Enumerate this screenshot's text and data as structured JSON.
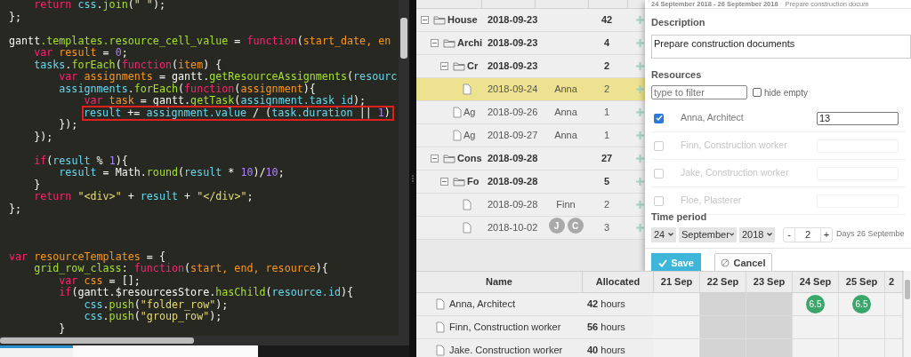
{
  "code_editor": {
    "lines": [
      {
        "kind": "code",
        "highlighted": false,
        "tokens": [
          {
            "text": "    return ",
            "kind": "k"
          },
          {
            "text": "css",
            "kind": "i"
          },
          {
            "text": ".",
            "kind": "p"
          },
          {
            "text": "join",
            "kind": "f"
          },
          {
            "text": "(",
            "kind": "p"
          },
          {
            "text": "\" \"",
            "kind": "s"
          },
          {
            "text": ");",
            "kind": "p"
          }
        ]
      },
      {
        "kind": "code",
        "highlighted": false,
        "tokens": [
          {
            "text": "};",
            "kind": "p"
          }
        ]
      },
      {
        "kind": "blank"
      },
      {
        "kind": "code",
        "highlighted": false,
        "tokens": [
          {
            "text": "gantt",
            "kind": "p"
          },
          {
            "text": ".templates.resource_cell_value",
            "kind": "f"
          },
          {
            "text": " = ",
            "kind": "p"
          },
          {
            "text": "function",
            "kind": "k"
          },
          {
            "text": "(",
            "kind": "p"
          },
          {
            "text": "start_date, en",
            "kind": "v"
          }
        ]
      },
      {
        "kind": "code",
        "highlighted": false,
        "tokens": [
          {
            "text": "    var ",
            "kind": "k"
          },
          {
            "text": "result",
            "kind": "v"
          },
          {
            "text": " = ",
            "kind": "p"
          },
          {
            "text": "0",
            "kind": "n"
          },
          {
            "text": ";",
            "kind": "p"
          }
        ]
      },
      {
        "kind": "code",
        "highlighted": false,
        "tokens": [
          {
            "text": "    tasks",
            "kind": "i"
          },
          {
            "text": ".",
            "kind": "p"
          },
          {
            "text": "forEach",
            "kind": "f"
          },
          {
            "text": "(",
            "kind": "p"
          },
          {
            "text": "function",
            "kind": "k"
          },
          {
            "text": "(",
            "kind": "p"
          },
          {
            "text": "item",
            "kind": "v"
          },
          {
            "text": ") {",
            "kind": "p"
          }
        ]
      },
      {
        "kind": "code",
        "highlighted": false,
        "tokens": [
          {
            "text": "        var ",
            "kind": "k"
          },
          {
            "text": "assignments",
            "kind": "v"
          },
          {
            "text": " = gantt.",
            "kind": "p"
          },
          {
            "text": "getResourceAssignments",
            "kind": "f"
          },
          {
            "text": "(",
            "kind": "p"
          },
          {
            "text": "resourc",
            "kind": "i"
          }
        ]
      },
      {
        "kind": "code",
        "highlighted": false,
        "tokens": [
          {
            "text": "        assignments",
            "kind": "i"
          },
          {
            "text": ".",
            "kind": "p"
          },
          {
            "text": "forEach",
            "kind": "f"
          },
          {
            "text": "(",
            "kind": "p"
          },
          {
            "text": "function",
            "kind": "k"
          },
          {
            "text": "(",
            "kind": "p"
          },
          {
            "text": "assignment",
            "kind": "v"
          },
          {
            "text": "){",
            "kind": "p"
          }
        ]
      },
      {
        "kind": "code",
        "highlighted": false,
        "tokens": [
          {
            "text": "            var ",
            "kind": "k"
          },
          {
            "text": "task",
            "kind": "v"
          },
          {
            "text": " = gantt.",
            "kind": "p"
          },
          {
            "text": "getTask",
            "kind": "f"
          },
          {
            "text": "(",
            "kind": "p"
          },
          {
            "text": "assignment.task_id",
            "kind": "i"
          },
          {
            "text": ");",
            "kind": "p"
          }
        ]
      },
      {
        "kind": "code",
        "highlighted": true,
        "tokens": [
          {
            "text": "result",
            "kind": "i"
          },
          {
            "text": " += ",
            "kind": "p"
          },
          {
            "text": "assignment.value",
            "kind": "i"
          },
          {
            "text": " / (",
            "kind": "p"
          },
          {
            "text": "task.duration",
            "kind": "i"
          },
          {
            "text": " || ",
            "kind": "p"
          },
          {
            "text": "1",
            "kind": "n"
          },
          {
            "text": ")",
            "kind": "p"
          }
        ]
      },
      {
        "kind": "code",
        "highlighted": false,
        "tokens": [
          {
            "text": "        });",
            "kind": "p"
          }
        ]
      },
      {
        "kind": "code",
        "highlighted": false,
        "tokens": [
          {
            "text": "    });",
            "kind": "p"
          }
        ]
      },
      {
        "kind": "blank"
      },
      {
        "kind": "code",
        "highlighted": false,
        "tokens": [
          {
            "text": "    if",
            "kind": "k"
          },
          {
            "text": "(",
            "kind": "p"
          },
          {
            "text": "result",
            "kind": "i"
          },
          {
            "text": " % ",
            "kind": "p"
          },
          {
            "text": "1",
            "kind": "n"
          },
          {
            "text": "){",
            "kind": "p"
          }
        ]
      },
      {
        "kind": "code",
        "highlighted": false,
        "tokens": [
          {
            "text": "        result",
            "kind": "i"
          },
          {
            "text": " = Math.",
            "kind": "p"
          },
          {
            "text": "round",
            "kind": "f"
          },
          {
            "text": "(",
            "kind": "p"
          },
          {
            "text": "result",
            "kind": "i"
          },
          {
            "text": " * ",
            "kind": "p"
          },
          {
            "text": "10",
            "kind": "n"
          },
          {
            "text": ")/",
            "kind": "p"
          },
          {
            "text": "10",
            "kind": "n"
          },
          {
            "text": ";",
            "kind": "p"
          }
        ]
      },
      {
        "kind": "code",
        "highlighted": false,
        "tokens": [
          {
            "text": "    }",
            "kind": "p"
          }
        ]
      },
      {
        "kind": "code",
        "highlighted": false,
        "tokens": [
          {
            "text": "    return ",
            "kind": "k"
          },
          {
            "text": "\"<div>\"",
            "kind": "s"
          },
          {
            "text": " + ",
            "kind": "p"
          },
          {
            "text": "result",
            "kind": "i"
          },
          {
            "text": " + ",
            "kind": "p"
          },
          {
            "text": "\"</div>\"",
            "kind": "s"
          },
          {
            "text": ";",
            "kind": "p"
          }
        ]
      },
      {
        "kind": "code",
        "highlighted": false,
        "tokens": [
          {
            "text": "};",
            "kind": "p"
          }
        ]
      },
      {
        "kind": "blank"
      },
      {
        "kind": "blank"
      },
      {
        "kind": "blank"
      },
      {
        "kind": "code",
        "highlighted": false,
        "tokens": [
          {
            "text": "var ",
            "kind": "k"
          },
          {
            "text": "resourceTemplates",
            "kind": "v"
          },
          {
            "text": " = {",
            "kind": "p"
          }
        ]
      },
      {
        "kind": "code",
        "highlighted": false,
        "tokens": [
          {
            "text": "    grid_row_class",
            "kind": "f"
          },
          {
            "text": ": ",
            "kind": "p"
          },
          {
            "text": "function",
            "kind": "k"
          },
          {
            "text": "(",
            "kind": "p"
          },
          {
            "text": "start, end, resource",
            "kind": "v"
          },
          {
            "text": "){",
            "kind": "p"
          }
        ]
      },
      {
        "kind": "code",
        "highlighted": false,
        "tokens": [
          {
            "text": "        var ",
            "kind": "k"
          },
          {
            "text": "css",
            "kind": "v"
          },
          {
            "text": " = [];",
            "kind": "p"
          }
        ]
      },
      {
        "kind": "code",
        "highlighted": false,
        "tokens": [
          {
            "text": "        if",
            "kind": "k"
          },
          {
            "text": "(gantt.$resourcesStore.",
            "kind": "p"
          },
          {
            "text": "hasChild",
            "kind": "f"
          },
          {
            "text": "(",
            "kind": "p"
          },
          {
            "text": "resource.id",
            "kind": "i"
          },
          {
            "text": "){",
            "kind": "p"
          }
        ]
      },
      {
        "kind": "code",
        "highlighted": false,
        "tokens": [
          {
            "text": "            css",
            "kind": "i"
          },
          {
            "text": ".",
            "kind": "p"
          },
          {
            "text": "push",
            "kind": "f"
          },
          {
            "text": "(",
            "kind": "p"
          },
          {
            "text": "\"folder_row\"",
            "kind": "s"
          },
          {
            "text": ");",
            "kind": "p"
          }
        ]
      },
      {
        "kind": "code",
        "highlighted": false,
        "tokens": [
          {
            "text": "            css",
            "kind": "i"
          },
          {
            "text": ".",
            "kind": "p"
          },
          {
            "text": "push",
            "kind": "f"
          },
          {
            "text": "(",
            "kind": "p"
          },
          {
            "text": "\"group_row\"",
            "kind": "s"
          },
          {
            "text": ");",
            "kind": "p"
          }
        ]
      },
      {
        "kind": "code",
        "highlighted": false,
        "tokens": [
          {
            "text": "        }",
            "kind": "p"
          }
        ]
      }
    ]
  },
  "task_grid": {
    "rows": [
      {
        "kind": "folder",
        "name": "House",
        "expanded": true,
        "start": "2018-09-23",
        "duration": "42",
        "selected": false,
        "children": [
          {
            "kind": "folder",
            "name": "Archi",
            "expanded": true,
            "start": "2018-09-23",
            "duration": "4",
            "selected": false,
            "children": [
              {
                "kind": "folder",
                "name": "Cr",
                "expanded": true,
                "start": "2018-09-23",
                "duration": "2",
                "selected": false,
                "children": [
                  {
                    "kind": "task",
                    "start": "2018-09-24",
                    "assigned": [
                      "Anna"
                    ],
                    "duration": "2",
                    "selected": true
                  }
                ]
              },
              {
                "kind": "task",
                "name": "Ag",
                "start": "2018-09-26",
                "assigned": [
                  "Anna"
                ],
                "duration": "1",
                "selected": false
              },
              {
                "kind": "task",
                "name": "Ag",
                "start": "2018-09-27",
                "assigned": [
                  "Anna"
                ],
                "duration": "1",
                "selected": false
              }
            ]
          },
          {
            "kind": "folder",
            "name": "Cons",
            "expanded": true,
            "start": "2018-09-28",
            "duration": "27",
            "selected": false,
            "children": [
              {
                "kind": "folder",
                "name": "Fo",
                "expanded": true,
                "start": "2018-09-28",
                "duration": "5",
                "selected": false,
                "children": [
                  {
                    "kind": "task",
                    "start": "2018-09-28",
                    "assigned": [
                      "Finn"
                    ],
                    "duration": "2",
                    "selected": false
                  },
                  {
                    "kind": "task",
                    "start": "2018-10-02",
                    "avatars": [
                      "J",
                      "C"
                    ],
                    "duration": "3",
                    "selected": false
                  }
                ]
              }
            ]
          }
        ]
      }
    ]
  },
  "lightbox": {
    "header": {
      "dates": "24 September 2018 - 26 September 2018",
      "title": "Prepare construction docum"
    },
    "description": {
      "label": "Description",
      "value": "Prepare construction documents"
    },
    "resources": {
      "label": "Resources",
      "filter_placeholder": "type to filter",
      "hide_empty": {
        "label": "hide empty",
        "checked": false
      },
      "items": [
        {
          "name": "Anna, Architect",
          "checked": true,
          "value": "13"
        },
        {
          "name": "Finn, Construction worker",
          "checked": false
        },
        {
          "name": "Jake, Construction worker",
          "checked": false
        },
        {
          "name": "Floe, Plasterer",
          "checked": false
        }
      ]
    },
    "time_period": {
      "label": "Time period",
      "day": "24",
      "month": "September",
      "year": "2018",
      "minus": "-",
      "duration": "2",
      "plus": "+",
      "end_text": "Days 26 Septembe"
    },
    "buttons": [
      {
        "label": "Save",
        "kind": "primary"
      },
      {
        "label": "Cancel",
        "kind": "secondary"
      }
    ]
  },
  "resource_grid": {
    "columns": [
      "Name",
      "Allocated"
    ],
    "days": [
      {
        "label": "21 Sep",
        "weekend": false
      },
      {
        "label": "22 Sep",
        "weekend": true
      },
      {
        "label": "23 Sep",
        "weekend": true
      },
      {
        "label": "24 Sep",
        "weekend": false
      },
      {
        "label": "25 Sep",
        "weekend": false
      },
      {
        "label": "2",
        "weekend": false
      }
    ],
    "rows": [
      {
        "name": "Anna, Architect",
        "allocated": "**42** hours",
        "cells": [
          {
            "kind": "empty"
          },
          {
            "kind": "empty"
          },
          {
            "kind": "empty"
          },
          {
            "kind": "load",
            "value": "6.5"
          },
          {
            "kind": "load",
            "value": "6.5"
          },
          {
            "kind": "empty"
          }
        ]
      },
      {
        "name": "Finn, Construction worker",
        "allocated": "**56** hours",
        "cells": [
          {
            "kind": "empty"
          },
          {
            "kind": "empty"
          },
          {
            "kind": "empty"
          },
          {
            "kind": "empty"
          },
          {
            "kind": "empty"
          },
          {
            "kind": "empty"
          }
        ]
      },
      {
        "name": "Jake. Construction worker",
        "allocated": "**40** hours",
        "cells": [
          {
            "kind": "empty"
          },
          {
            "kind": "empty"
          },
          {
            "kind": "empty"
          },
          {
            "kind": "empty"
          },
          {
            "kind": "empty"
          },
          {
            "kind": "empty"
          }
        ]
      }
    ]
  }
}
